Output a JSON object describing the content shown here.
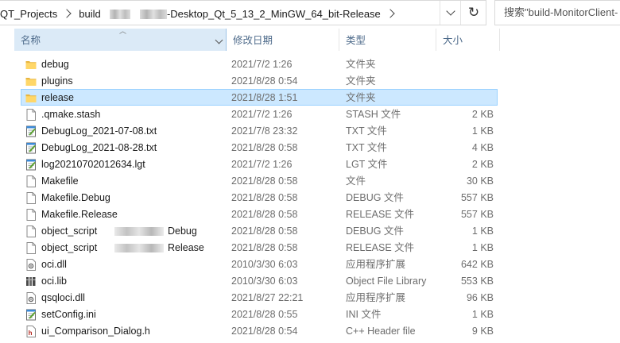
{
  "address_bar": {
    "crumbs": [
      "QT_Projects",
      "build",
      "-Desktop_Qt_5_13_2_MinGW_64_bit-Release"
    ],
    "refresh_icon": "refresh-icon"
  },
  "search": {
    "placeholder": "搜索\"build-MonitorClient-"
  },
  "columns": {
    "name": "名称",
    "date": "修改日期",
    "type": "类型",
    "size": "大小"
  },
  "files": [
    {
      "name": "debug",
      "date": "2021/7/2 1:26",
      "type": "文件夹",
      "size": "",
      "icon": "folder-icon"
    },
    {
      "name": "plugins",
      "date": "2021/8/28 0:54",
      "type": "文件夹",
      "size": "",
      "icon": "folder-icon"
    },
    {
      "name": "release",
      "date": "2021/8/28 1:51",
      "type": "文件夹",
      "size": "",
      "icon": "folder-icon",
      "selected": true
    },
    {
      "name": ".qmake.stash",
      "date": "2021/7/2 1:26",
      "type": "STASH 文件",
      "size": "2 KB",
      "icon": "file-icon"
    },
    {
      "name": "DebugLog_2021-07-08.txt",
      "date": "2021/7/8 23:32",
      "type": "TXT 文件",
      "size": "1 KB",
      "icon": "notepad-icon"
    },
    {
      "name": "DebugLog_2021-08-28.txt",
      "date": "2021/8/28 0:58",
      "type": "TXT 文件",
      "size": "4 KB",
      "icon": "notepad-icon"
    },
    {
      "name": "log20210702012634.lgt",
      "date": "2021/7/2 1:26",
      "type": "LGT 文件",
      "size": "2 KB",
      "icon": "notepad-icon"
    },
    {
      "name": "Makefile",
      "date": "2021/8/28 0:58",
      "type": "文件",
      "size": "30 KB",
      "icon": "file-icon"
    },
    {
      "name": "Makefile.Debug",
      "date": "2021/8/28 0:58",
      "type": "DEBUG 文件",
      "size": "557 KB",
      "icon": "file-icon"
    },
    {
      "name": "Makefile.Release",
      "date": "2021/8/28 0:58",
      "type": "RELEASE 文件",
      "size": "557 KB",
      "icon": "file-icon"
    },
    {
      "name": "object_script",
      "suffix": "Debug",
      "date": "2021/8/28 0:58",
      "type": "DEBUG 文件",
      "size": "1 KB",
      "icon": "file-icon"
    },
    {
      "name": "object_script",
      "suffix": "Release",
      "date": "2021/8/28 0:58",
      "type": "RELEASE 文件",
      "size": "1 KB",
      "icon": "file-icon"
    },
    {
      "name": "oci.dll",
      "date": "2010/3/30 6:03",
      "type": "应用程序扩展",
      "size": "642 KB",
      "icon": "dll-icon"
    },
    {
      "name": "oci.lib",
      "date": "2010/3/30 6:03",
      "type": "Object File Library",
      "size": "553 KB",
      "icon": "lib-icon"
    },
    {
      "name": "qsqloci.dll",
      "date": "2021/8/27 22:21",
      "type": "应用程序扩展",
      "size": "96 KB",
      "icon": "dll-icon"
    },
    {
      "name": "setConfig.ini",
      "date": "2021/8/28 0:55",
      "type": "INI 文件",
      "size": "1 KB",
      "icon": "notepad-icon"
    },
    {
      "name": "ui_Comparison_Dialog.h",
      "date": "2021/8/28 0:54",
      "type": "C++ Header file",
      "size": "9 KB",
      "icon": "header-icon"
    }
  ]
}
